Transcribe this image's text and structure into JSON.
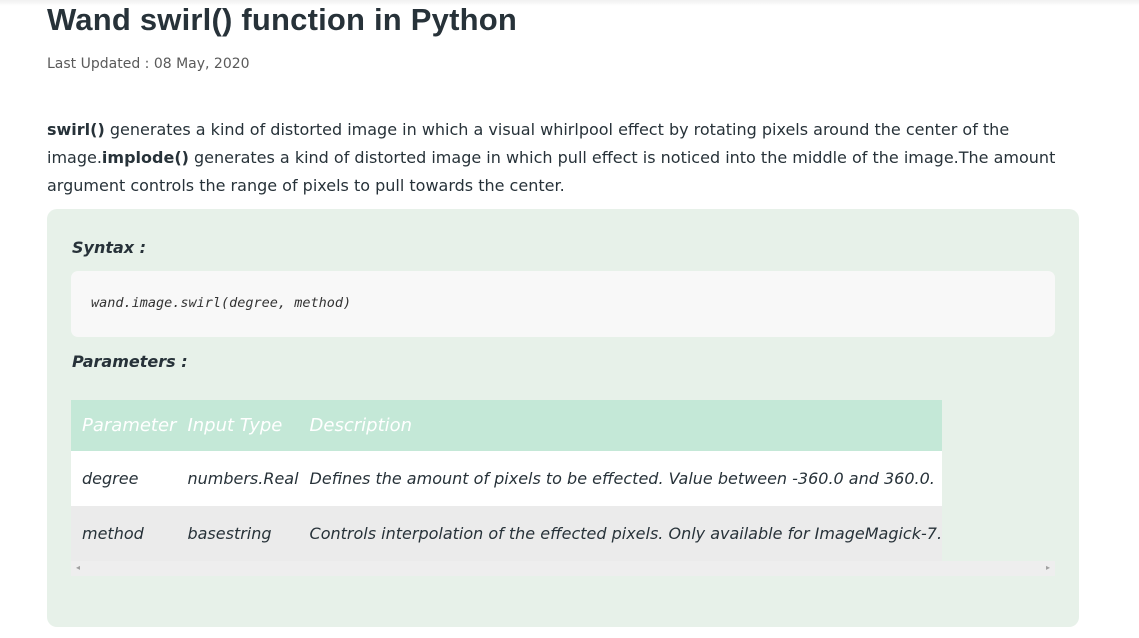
{
  "article": {
    "title": "Wand swirl() function in Python",
    "last_updated": "Last Updated : 08 May, 2020",
    "intro": {
      "swirl_name": "swirl()",
      "swirl_text": " generates a kind of distorted image in which a visual whirlpool effect by rotating pixels around the center of the image.",
      "implode_name": "implode()",
      "implode_text": " generates a kind of distorted image in which pull effect is noticed into the middle of the image.The amount argument controls the range of pixels to pull towards the center."
    },
    "syntax_label": "Syntax :",
    "syntax_code": "wand.image.swirl(degree, method)",
    "parameters_label": "Parameters :",
    "parameters_table": {
      "headers": [
        "Parameter",
        "Input Type",
        "Description"
      ],
      "rows": [
        [
          "degree",
          "numbers.Real",
          "Defines the amount of pixels to be effected. Value between -360.0 and 360.0."
        ],
        [
          "method",
          "basestring",
          "Controls interpolation of the effected pixels. Only available for ImageMagick-7."
        ]
      ]
    },
    "scrollbar": {
      "left_arrow": "◂",
      "right_arrow": "▸"
    }
  }
}
